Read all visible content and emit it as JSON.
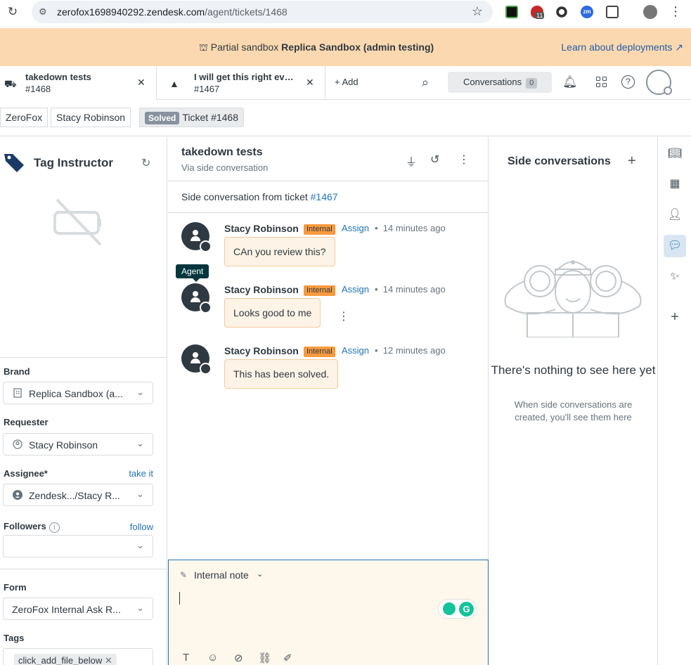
{
  "browser": {
    "url_host": "zerofox1698940292.zendesk.com",
    "url_path": "/agent/tickets/1468",
    "ext_badge": "11",
    "ext_zm_label": "zm"
  },
  "banner": {
    "prefix": "Partial sandbox",
    "sandbox_name": "Replica Sandbox (admin testing)",
    "link": "Learn about deployments"
  },
  "tabs": [
    {
      "title": "takedown tests",
      "number": "#1468"
    },
    {
      "title": "I will get this right eve...",
      "number": "#1467"
    }
  ],
  "topbar": {
    "add_label": "Add",
    "conversations_label": "Conversations",
    "conversations_count": "0"
  },
  "breadcrumb": {
    "org": "ZeroFox",
    "requester": "Stacy Robinson",
    "status": "Solved",
    "ticket": "Ticket #1468"
  },
  "left": {
    "app_title": "Tag Instructor",
    "brand_label": "Brand",
    "brand_value": "Replica Sandbox (a...",
    "requester_label": "Requester",
    "requester_value": "Stacy Robinson",
    "assignee_label": "Assignee*",
    "assignee_link": "take it",
    "assignee_value": "Zendesk.../Stacy R...",
    "followers_label": "Followers",
    "followers_link": "follow",
    "followers_value": "",
    "form_label": "Form",
    "form_value": "ZeroFox Internal Ask R...",
    "tags_label": "Tags",
    "tag_value": "click_add_file_below"
  },
  "middle": {
    "title": "takedown tests",
    "subtitle": "Via side conversation",
    "side_from_text": "Side conversation from ticket",
    "side_from_link": "#1467",
    "tooltip": "Agent",
    "messages": [
      {
        "author": "Stacy Robinson",
        "badge": "Internal",
        "assign": "Assign",
        "time": "14 minutes ago",
        "body": "CAn you review this?"
      },
      {
        "author": "Stacy Robinson",
        "badge": "Internal",
        "assign": "Assign",
        "time": "14 minutes ago",
        "body": "Looks good to me"
      },
      {
        "author": "Stacy Robinson",
        "badge": "Internal",
        "assign": "Assign",
        "time": "12 minutes ago",
        "body": "This has been solved."
      }
    ],
    "composer_mode": "Internal note"
  },
  "right": {
    "title": "Side conversations",
    "empty_title": "There's nothing to see here yet",
    "empty_sub": "When side conversations are created, you'll see them here"
  },
  "colors": {
    "banner": "#fcd8b0",
    "internal_badge": "#f79a3e",
    "link": "#1f73b7",
    "bubble": "#fdf3e6",
    "composer": "#fef7ec"
  }
}
